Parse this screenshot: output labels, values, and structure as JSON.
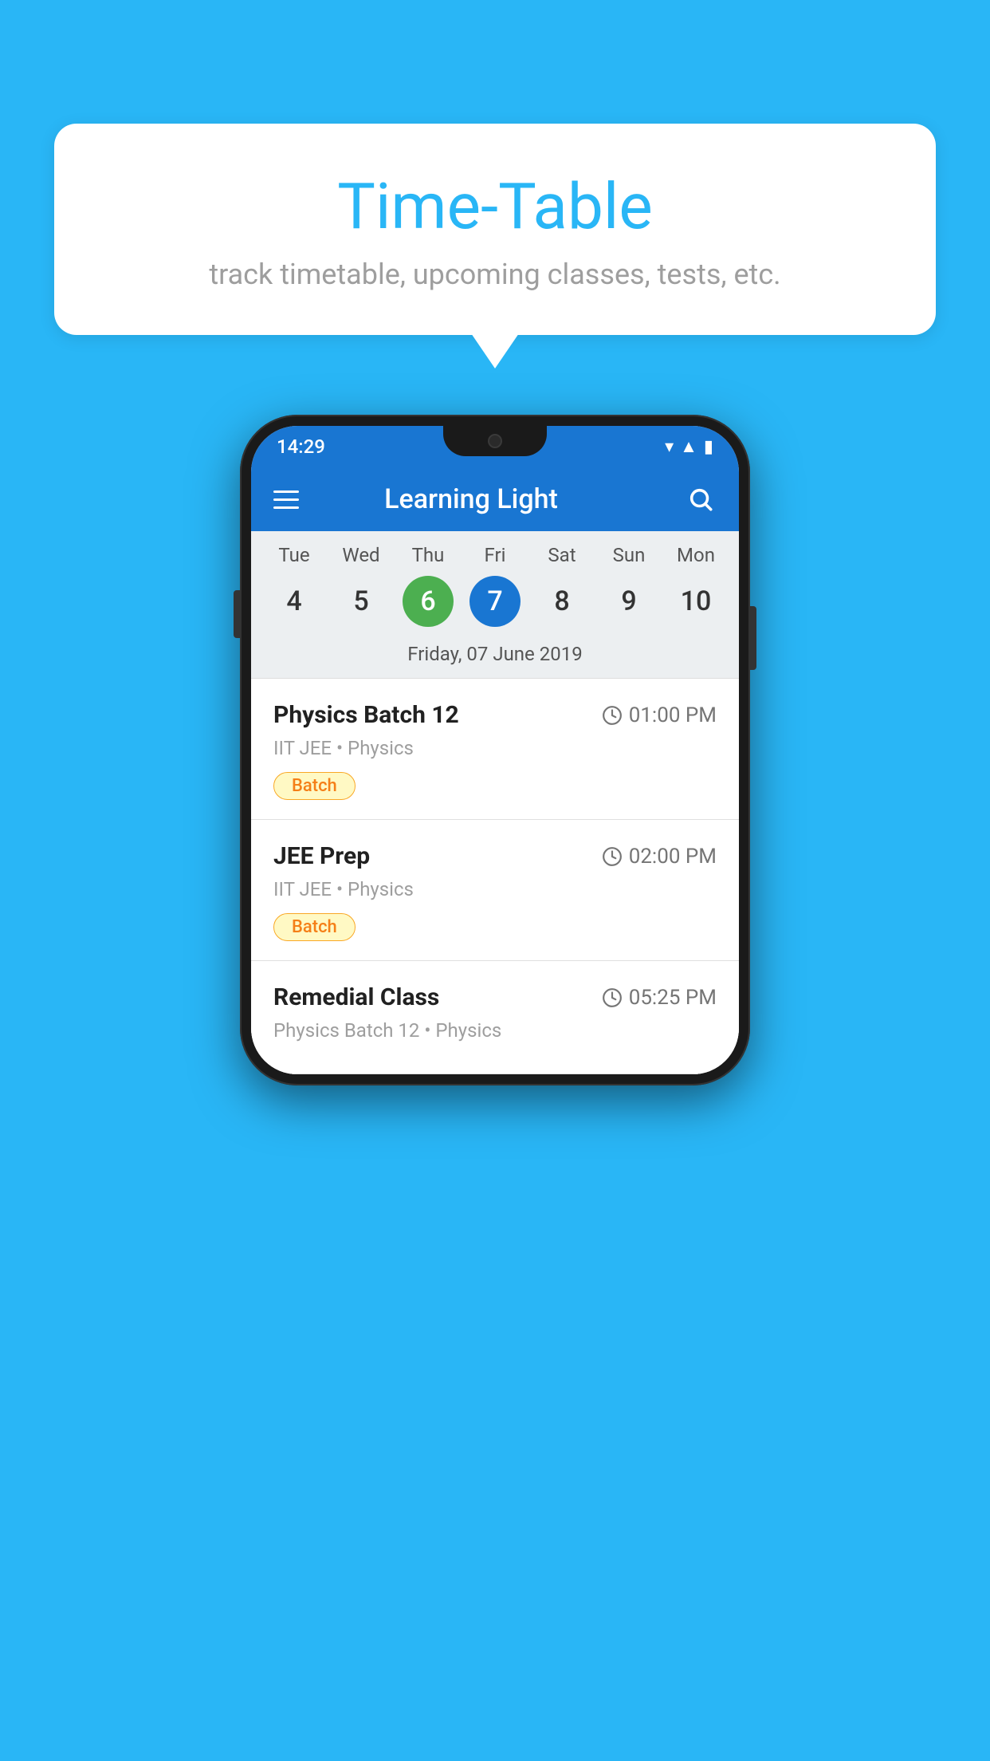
{
  "background": {
    "color": "#29B6F6"
  },
  "speech_bubble": {
    "title": "Time-Table",
    "subtitle": "track timetable, upcoming classes, tests, etc."
  },
  "phone": {
    "status_bar": {
      "time": "14:29"
    },
    "app_bar": {
      "title": "Learning Light",
      "hamburger_label": "menu",
      "search_label": "search"
    },
    "calendar": {
      "day_names": [
        "Tue",
        "Wed",
        "Thu",
        "Fri",
        "Sat",
        "Sun",
        "Mon"
      ],
      "dates": [
        "4",
        "5",
        "6",
        "7",
        "8",
        "9",
        "10"
      ],
      "today_index": 2,
      "selected_index": 3,
      "selected_label": "Friday, 07 June 2019"
    },
    "schedule": [
      {
        "title": "Physics Batch 12",
        "time": "01:00 PM",
        "subtitle": "IIT JEE • Physics",
        "badge": "Batch"
      },
      {
        "title": "JEE Prep",
        "time": "02:00 PM",
        "subtitle": "IIT JEE • Physics",
        "badge": "Batch"
      },
      {
        "title": "Remedial Class",
        "time": "05:25 PM",
        "subtitle": "Physics Batch 12 • Physics",
        "badge": ""
      }
    ]
  }
}
